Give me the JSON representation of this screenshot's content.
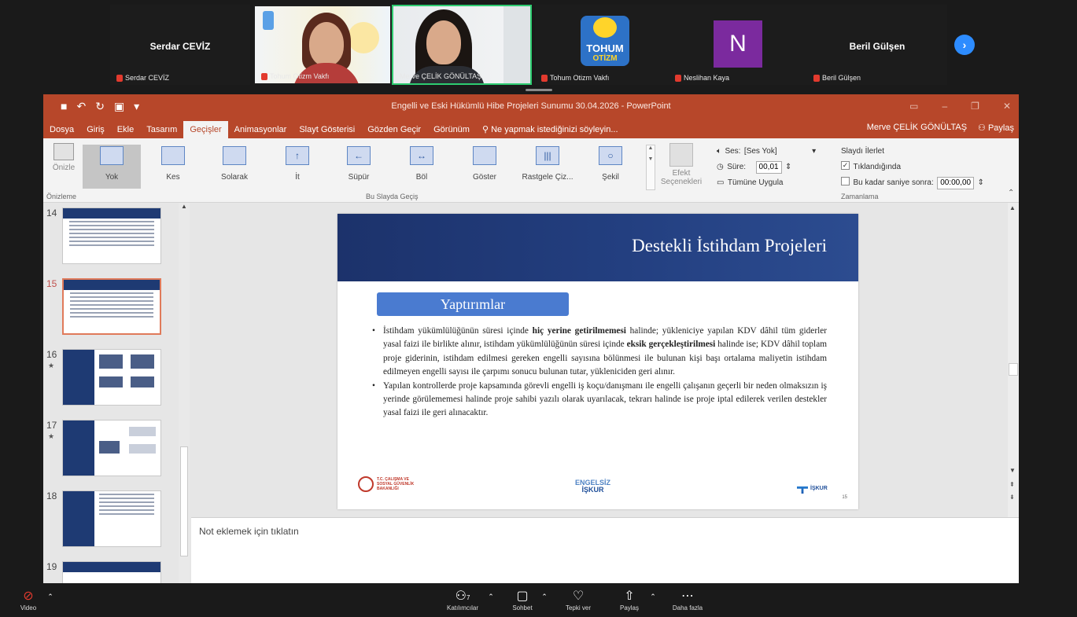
{
  "participants": [
    {
      "center_name": "Serdar CEVİZ",
      "label": "Serdar CEVİZ",
      "type": "name"
    },
    {
      "label": "Tohum Otizm Vakfı",
      "type": "video"
    },
    {
      "label": "Merve ÇELİK GÖNÜLTAŞ",
      "type": "video-active"
    },
    {
      "label": "Tohum Otizm Vakfı",
      "type": "logo",
      "logo_line1": "TOHUM",
      "logo_line2": "OTİZM"
    },
    {
      "label": "Neslihan Kaya",
      "type": "avatar",
      "avatar_letter": "N"
    },
    {
      "center_name": "Beril Gülşen",
      "label": "Beril Gülşen",
      "type": "name"
    }
  ],
  "ppt": {
    "doc_title": "Engelli ve Eski Hükümlü Hibe Projeleri Sunumu 30.04.2026 - PowerPoint",
    "menus": [
      "Dosya",
      "Giriş",
      "Ekle",
      "Tasarım",
      "Geçişler",
      "Animasyonlar",
      "Slayt Gösterisi",
      "Gözden Geçir",
      "Görünüm",
      "Ne yapmak istediğinizi söyleyin..."
    ],
    "active_menu_index": 4,
    "user_name": "Merve ÇELİK GÖNÜLTAŞ",
    "share_label": "Paylaş",
    "ribbon": {
      "preview_label": "Önizle",
      "preview_group": "Önizleme",
      "effects": [
        "Yok",
        "Kes",
        "Solarak",
        "İt",
        "Süpür",
        "Böl",
        "Göster",
        "Rastgele Çiz...",
        "Şekil"
      ],
      "selected_effect_index": 0,
      "transition_group": "Bu Slayda Geçiş",
      "effect_options": "Efekt Seçenekleri",
      "sound_label": "Ses:",
      "sound_value": "[Ses Yok]",
      "duration_label": "Süre:",
      "duration_value": "00,01",
      "apply_all": "Tümüne Uygula",
      "advance_label": "Slaydı İlerlet",
      "on_click": "Tıklandığında",
      "on_click_checked": true,
      "after_label": "Bu kadar saniye sonra:",
      "after_value": "00:00,00",
      "timing_group": "Zamanlama"
    },
    "thumbnails": [
      "14",
      "15",
      "16",
      "17",
      "18",
      "19"
    ],
    "selected_thumb": "15",
    "slide": {
      "title": "Destekli İstihdam Projeleri",
      "subtitle": "Yaptırımlar",
      "bullet1_a": "İstihdam yükümlülüğünün süresi içinde ",
      "bullet1_b": "hiç yerine getirilmemesi",
      "bullet1_c": " halinde; yükleniciye yapılan KDV dâhil tüm giderler yasal faizi ile birlikte alınır, istihdam yükümlülüğünün süresi içinde ",
      "bullet1_d": "eksik gerçekleştirilmesi",
      "bullet1_e": " halinde ise; KDV dâhil toplam proje giderinin, istihdam edilmesi gereken engelli sayısına bölünmesi ile bulunan kişi başı ortalama maliyetin istihdam edilmeyen engelli sayısı ile çarpımı sonucu bulunan tutar, yükleniciden geri alınır.",
      "bullet2": "Yapılan kontrollerde proje kapsamında görevli engelli iş koçu/danışmanı ile engelli çalışanın geçerli bir neden olmaksızın iş yerinde görülememesi halinde proje sahibi yazılı olarak uyarılacak, tekrarı halinde ise proje iptal edilerek verilen destekler yasal faizi ile geri alınacaktır.",
      "ministry": "T.C. ÇALIŞMA VE SOSYAL GÜVENLİK BAKANLIĞI",
      "engelsiz_1": "ENGELSİZ",
      "engelsiz_2": "İŞKUR",
      "iskur": "İŞKUR",
      "page_number": "15"
    },
    "notes_placeholder": "Not eklemek için tıklatın"
  },
  "zoom_toolbar": {
    "video": "Video",
    "participants": "Katılımcılar",
    "participant_count": "7",
    "chat": "Sohbet",
    "react": "Tepki ver",
    "share": "Paylaş",
    "more": "Daha fazla"
  }
}
